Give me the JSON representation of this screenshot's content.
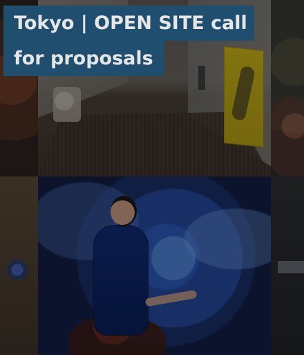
{
  "card": {
    "title_lines": [
      "Tokyo | OPEN SITE call",
      "for proposals"
    ]
  },
  "colors": {
    "title_background": "#1f4e6e",
    "title_text": "#e6e6e6",
    "overlay": "rgba(0,0,0,0.35)"
  },
  "images": [
    {
      "name": "gallery-installation-photo"
    },
    {
      "name": "performer-photo"
    }
  ]
}
